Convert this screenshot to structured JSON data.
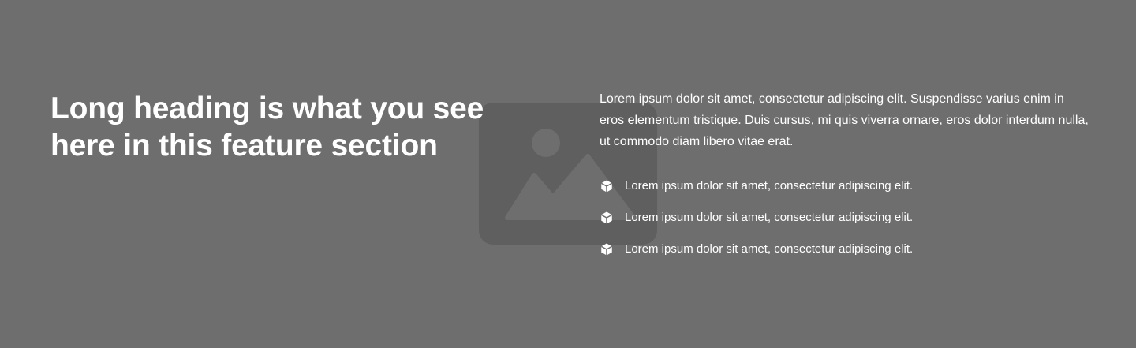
{
  "colors": {
    "background": "#6e6e6e",
    "placeholder": "#5f5f5f",
    "text": "#ffffff"
  },
  "background_image": {
    "icon": "image-placeholder-icon"
  },
  "heading": "Long heading is what you see here in this feature section",
  "paragraph": "Lorem ipsum dolor sit amet, consectetur adipiscing elit. Suspendisse varius enim in eros elementum tristique. Duis cursus, mi quis viverra ornare, eros dolor interdum nulla, ut commodo diam libero vitae erat.",
  "features": [
    {
      "icon": "cube-icon",
      "text": "Lorem ipsum dolor sit amet, consectetur adipiscing elit."
    },
    {
      "icon": "cube-icon",
      "text": "Lorem ipsum dolor sit amet, consectetur adipiscing elit."
    },
    {
      "icon": "cube-icon",
      "text": "Lorem ipsum dolor sit amet, consectetur adipiscing elit."
    }
  ]
}
